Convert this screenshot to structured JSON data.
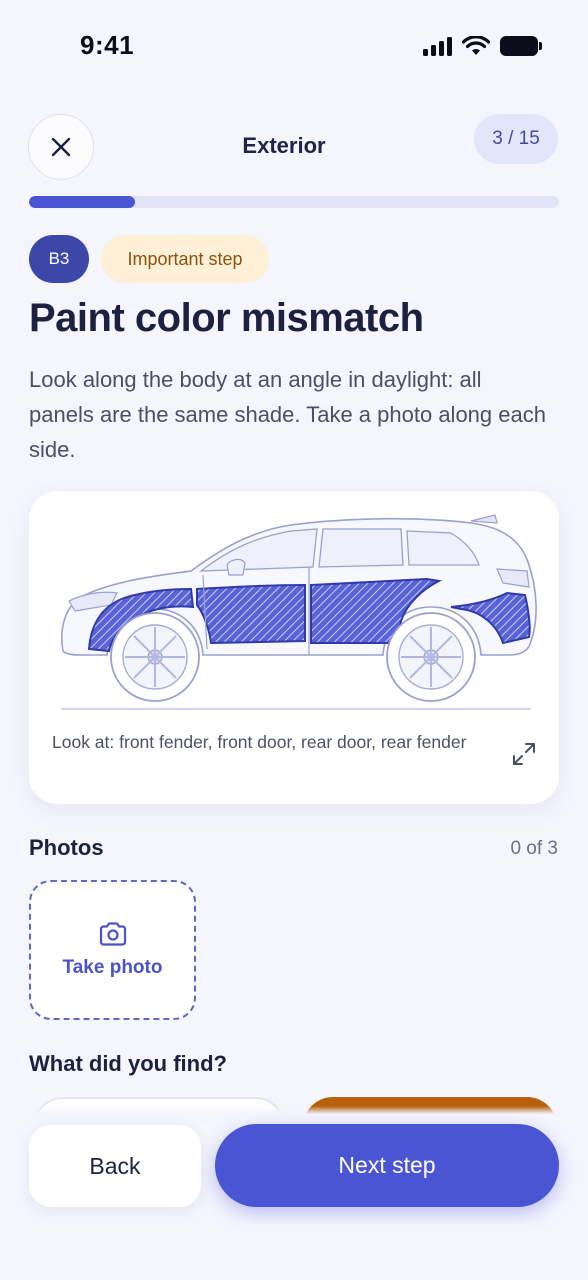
{
  "status_bar": {
    "time": "9:41",
    "icons": [
      "cellular-signal-icon",
      "wifi-icon",
      "battery-icon"
    ]
  },
  "header": {
    "close_icon": "close-icon",
    "title": "Exterior",
    "step_counter": "3 / 15"
  },
  "progress": {
    "fraction": 0.2
  },
  "step": {
    "code": "B3",
    "badge": "Important step",
    "title": "Paint color mismatch",
    "description": "Look along the body at an angle in daylight: all panels are the same shade. Take a photo along each side."
  },
  "illustration": {
    "subject": "car-side-view",
    "highlighted_parts": [
      "front fender",
      "front door",
      "rear door",
      "rear fender"
    ],
    "caption": "Look at: front fender, front door, rear door, rear fender",
    "expand_icon": "expand-icon"
  },
  "photos": {
    "label": "Photos",
    "count": "0 of 3",
    "take_photo_label": "Take photo",
    "camera_icon": "camera-icon"
  },
  "findings": {
    "label": "What did you find?"
  },
  "actions": {
    "back_label": "Back",
    "next_label": "Next step"
  },
  "colors": {
    "accent": "#4a55d3",
    "background": "#f4f5fd",
    "badge_code_bg": "#3c47a8",
    "important_bg": "#fdf0d6",
    "important_text": "#8b5310",
    "option_selected": "#b85f0c"
  }
}
